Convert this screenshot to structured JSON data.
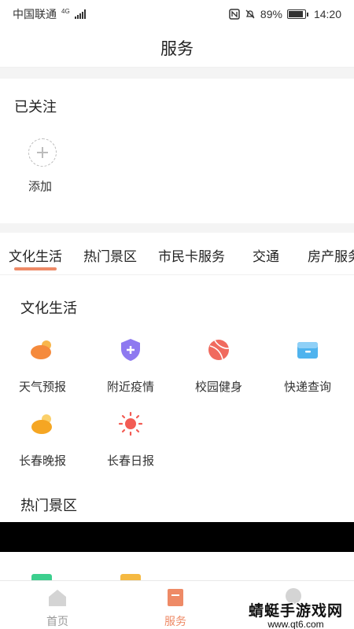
{
  "status_bar": {
    "carrier": "中国联通",
    "network": "4G",
    "battery": "89%",
    "battery_level": 0.89,
    "time": "14:20"
  },
  "header": {
    "title": "服务"
  },
  "followed": {
    "title": "已关注",
    "add_label": "添加"
  },
  "tabs": [
    {
      "label": "文化生活",
      "active": true
    },
    {
      "label": "热门景区",
      "active": false
    },
    {
      "label": "市民卡服务",
      "active": false
    },
    {
      "label": "交通",
      "active": false
    },
    {
      "label": "房产服务",
      "active": false
    }
  ],
  "sections": [
    {
      "title": "文化生活",
      "items": [
        {
          "label": "天气预报",
          "icon": "weather-icon",
          "color": "#f58a3c"
        },
        {
          "label": "附近疫情",
          "icon": "shield-plus-icon",
          "color": "#8e79f0"
        },
        {
          "label": "校园健身",
          "icon": "basketball-icon",
          "color": "#f06a5e"
        },
        {
          "label": "快递查询",
          "icon": "package-box-icon",
          "color": "#4fb3ee"
        },
        {
          "label": "长春晚报",
          "icon": "moon-cloud-icon",
          "color": "#f5a623"
        },
        {
          "label": "长春日报",
          "icon": "sun-icon",
          "color": "#f25c54"
        }
      ]
    },
    {
      "title": "热门景区"
    }
  ],
  "bottom_nav": [
    {
      "label": "首页",
      "icon": "home-icon",
      "active": false
    },
    {
      "label": "服务",
      "icon": "service-icon",
      "active": true
    },
    {
      "label": "",
      "icon": "profile-icon",
      "active": false
    }
  ],
  "watermark": {
    "main": "蜻蜓手游戏网",
    "sub": "www.qt6.com"
  },
  "colors": {
    "accent": "#ee8a66",
    "inactive": "#999999"
  }
}
